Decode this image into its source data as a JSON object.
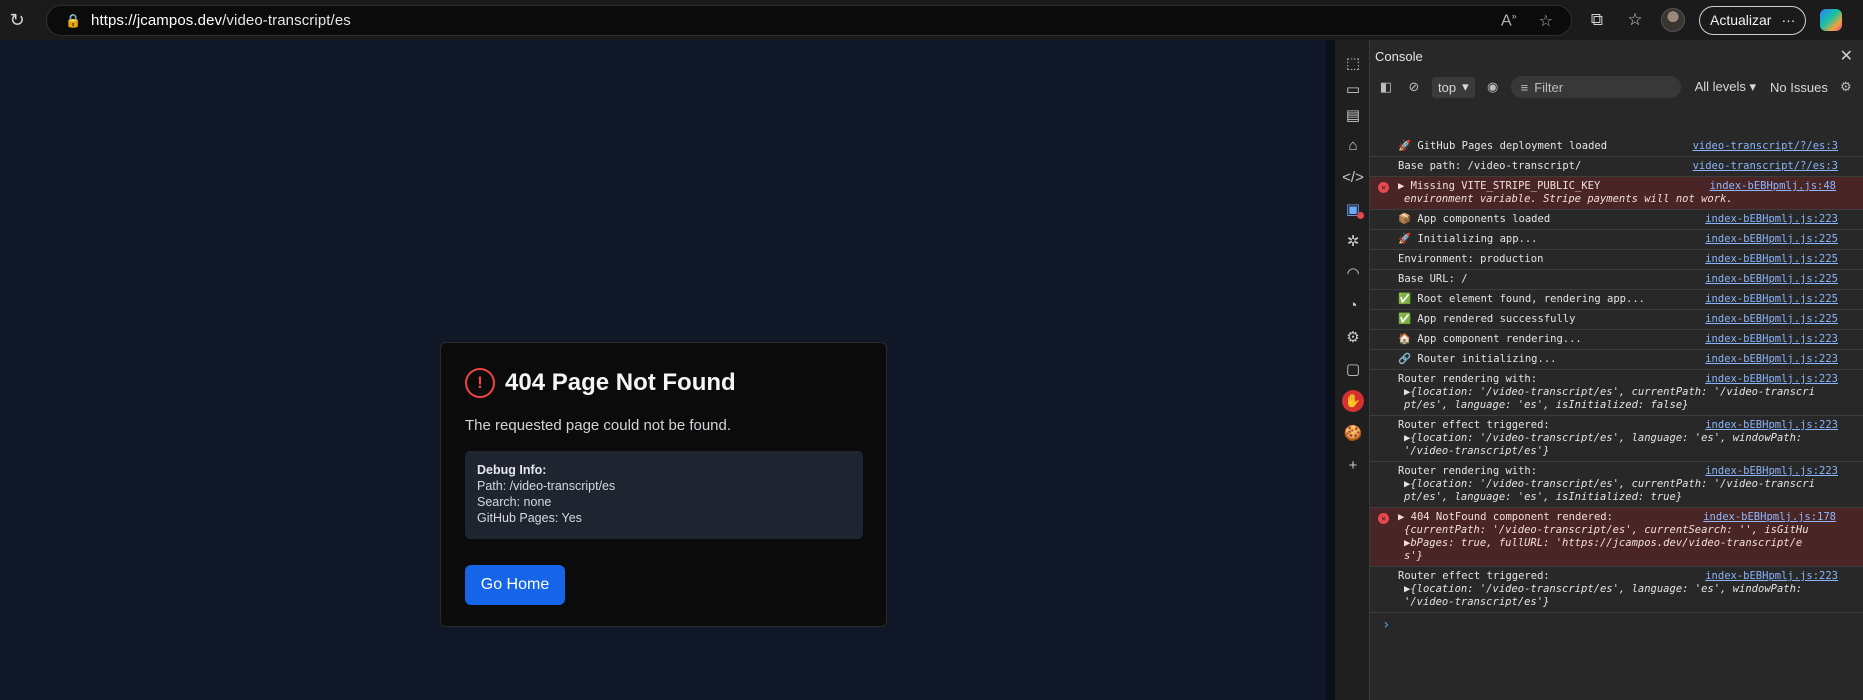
{
  "browser": {
    "url_host": "https://jcampos.dev",
    "url_path": "/video-transcript/es",
    "update_label": "Actualizar",
    "more_label": "···"
  },
  "page": {
    "title": "404 Page Not Found",
    "message": "The requested page could not be found.",
    "debug": {
      "heading": "Debug Info:",
      "path": "Path: /video-transcript/es",
      "search": "Search: none",
      "github": "GitHub Pages: Yes"
    },
    "button": "Go Home"
  },
  "console": {
    "title": "Console",
    "context": "top",
    "filter_placeholder": "Filter",
    "levels": "All levels",
    "issues": "No Issues",
    "logs": [
      {
        "type": "log",
        "lines": [
          "🚀 GitHub Pages deployment loaded"
        ],
        "src": "video-transcript/?/es:3"
      },
      {
        "type": "log",
        "lines": [
          "Base path: /video-transcript/"
        ],
        "src": "video-transcript/?/es:3"
      },
      {
        "type": "error",
        "lines": [
          "▶ Missing VITE_STRIPE_PUBLIC_KEY",
          "environment variable. Stripe payments will not work."
        ],
        "src": "index-bEBHpmlj.js:48"
      },
      {
        "type": "log",
        "lines": [
          "📦 App components loaded"
        ],
        "src": "index-bEBHpmlj.js:223"
      },
      {
        "type": "log",
        "lines": [
          "🚀 Initializing app..."
        ],
        "src": "index-bEBHpmlj.js:225"
      },
      {
        "type": "log",
        "lines": [
          "Environment: production"
        ],
        "src": "index-bEBHpmlj.js:225"
      },
      {
        "type": "log",
        "lines": [
          "Base URL: /"
        ],
        "src": "index-bEBHpmlj.js:225"
      },
      {
        "type": "log",
        "lines": [
          "✅ Root element found, rendering app..."
        ],
        "src": "index-bEBHpmlj.js:225"
      },
      {
        "type": "log",
        "lines": [
          "✅ App rendered successfully"
        ],
        "src": "index-bEBHpmlj.js:225"
      },
      {
        "type": "log",
        "lines": [
          "🏠 App component rendering..."
        ],
        "src": "index-bEBHpmlj.js:223"
      },
      {
        "type": "log",
        "lines": [
          "🔗 Router initializing..."
        ],
        "src": "index-bEBHpmlj.js:223"
      },
      {
        "type": "log",
        "lines": [
          "Router rendering with:",
          "▶{location: '/video-transcript/es', currentPath: '/video-transcri",
          " pt/es', language: 'es', isInitialized: false}"
        ],
        "src": "index-bEBHpmlj.js:223"
      },
      {
        "type": "log",
        "lines": [
          "Router effect triggered:",
          "▶{location: '/video-transcript/es', language: 'es', windowPath:",
          " '/video-transcript/es'}"
        ],
        "src": "index-bEBHpmlj.js:223"
      },
      {
        "type": "log",
        "lines": [
          "Router rendering with:",
          "▶{location: '/video-transcript/es', currentPath: '/video-transcri",
          " pt/es', language: 'es', isInitialized: true}"
        ],
        "src": "index-bEBHpmlj.js:223"
      },
      {
        "type": "error",
        "lines": [
          "▶ 404 NotFound component rendered:",
          " {currentPath: '/video-transcript/es', currentSearch: '', isGitHu",
          "▶bPages: true, fullURL: 'https://jcampos.dev/video-transcript/e",
          " s'}"
        ],
        "src": "index-bEBHpmlj.js:178"
      },
      {
        "type": "log",
        "lines": [
          "Router effect triggered:",
          "▶{location: '/video-transcript/es', language: 'es', windowPath:",
          " '/video-transcript/es'}"
        ],
        "src": "index-bEBHpmlj.js:223"
      }
    ],
    "prompt": "›"
  },
  "colors": {
    "page_bg": "#101828",
    "accent_button": "#1664e8",
    "error_red": "#ef4444"
  },
  "icons": [
    "reload-icon",
    "lock-icon",
    "read-aloud-icon",
    "favorite-star-icon",
    "extensions-icon",
    "favorites-icon",
    "profile-avatar",
    "copilot-icon",
    "close-icon",
    "filter-icon",
    "eye-icon",
    "gear-icon"
  ]
}
